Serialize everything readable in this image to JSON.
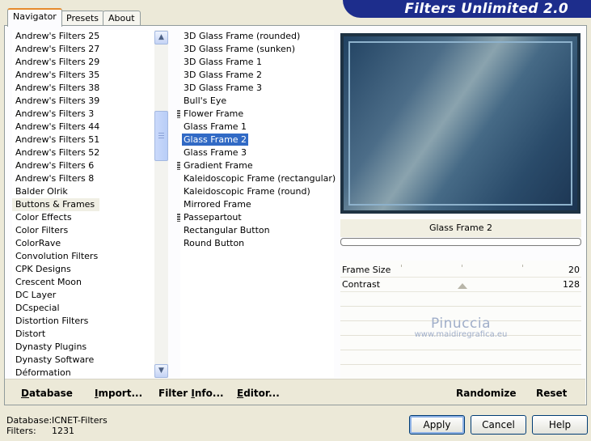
{
  "window": {
    "title": "Filters Unlimited 2.0"
  },
  "tabs": [
    {
      "label": "Navigator",
      "active": true
    },
    {
      "label": "Presets",
      "active": false
    },
    {
      "label": "About",
      "active": false
    }
  ],
  "categories": {
    "selected": "Buttons & Frames",
    "items": [
      "Andrew's Filters 25",
      "Andrew's Filters 27",
      "Andrew's Filters 29",
      "Andrew's Filters 35",
      "Andrew's Filters 38",
      "Andrew's Filters 39",
      "Andrew's Filters 3",
      "Andrew's Filters 44",
      "Andrew's Filters 51",
      "Andrew's Filters 52",
      "Andrew's Filters 6",
      "Andrew's Filters 8",
      "Balder Olrik",
      "Buttons & Frames",
      "Color Effects",
      "Color Filters",
      "ColorRave",
      "Convolution Filters",
      "CPK Designs",
      "Crescent Moon",
      "DC Layer",
      "DCspecial",
      "Distortion Filters",
      "Distort",
      "Dynasty Plugins",
      "Dynasty Software",
      "Déformation"
    ]
  },
  "filters": {
    "selected": "Glass Frame 2",
    "items": [
      {
        "label": "3D Glass Frame (rounded)",
        "marked": false
      },
      {
        "label": "3D Glass Frame (sunken)",
        "marked": false
      },
      {
        "label": "3D Glass Frame 1",
        "marked": false
      },
      {
        "label": "3D Glass Frame 2",
        "marked": false
      },
      {
        "label": "3D Glass Frame 3",
        "marked": false
      },
      {
        "label": "Bull's Eye",
        "marked": false
      },
      {
        "label": "Flower Frame",
        "marked": true
      },
      {
        "label": "Glass Frame 1",
        "marked": false
      },
      {
        "label": "Glass Frame 2",
        "marked": false
      },
      {
        "label": "Glass Frame 3",
        "marked": false
      },
      {
        "label": "Gradient Frame",
        "marked": true
      },
      {
        "label": "Kaleidoscopic Frame (rectangular)",
        "marked": false
      },
      {
        "label": "Kaleidoscopic Frame (round)",
        "marked": false
      },
      {
        "label": "Mirrored Frame",
        "marked": false
      },
      {
        "label": "Passepartout",
        "marked": true
      },
      {
        "label": "Rectangular Button",
        "marked": false
      },
      {
        "label": "Round Button",
        "marked": false
      }
    ]
  },
  "preview": {
    "filter_name": "Glass Frame 2",
    "progress": 0
  },
  "parameters": [
    {
      "label": "Frame Size",
      "value": "20"
    },
    {
      "label": "Contrast",
      "value": "128"
    }
  ],
  "watermark": {
    "name": "Pinuccia",
    "url": "www.maidiregrafica.eu"
  },
  "toolbar": {
    "database": {
      "key": "D",
      "rest": "atabase"
    },
    "import": {
      "pre": "",
      "key": "I",
      "rest": "mport..."
    },
    "filter_info": {
      "pre": "Filter ",
      "key": "I",
      "rest": "nfo..."
    },
    "editor": {
      "key": "E",
      "rest": "ditor..."
    },
    "randomize": "Randomize",
    "reset": "Reset"
  },
  "status": {
    "database_label": "Database:",
    "database_value": "ICNET-Filters",
    "filters_label": "Filters:",
    "filters_value": "1231"
  },
  "buttons": {
    "apply": "Apply",
    "cancel": "Cancel",
    "help": "Help"
  },
  "colors": {
    "banner": "#1d2d8c",
    "selection": "#316ac5",
    "tab_accent": "#e68b2c"
  }
}
